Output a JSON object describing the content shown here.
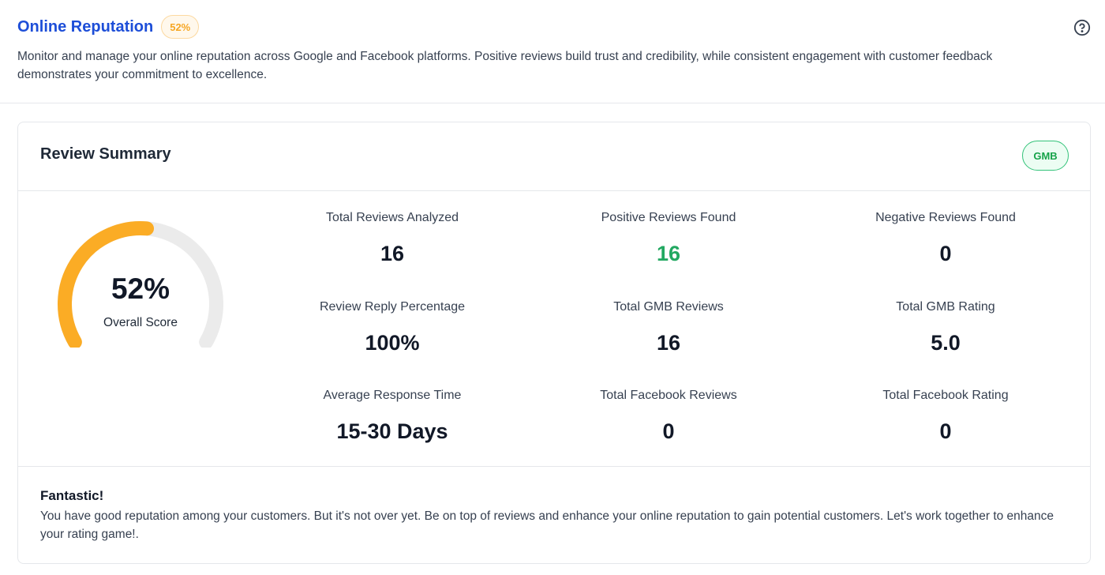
{
  "header": {
    "title": "Online Reputation",
    "score_pill": "52%",
    "description": "Monitor and manage your online reputation across Google and Facebook platforms. Positive reviews build trust and credibility, while consistent engagement with customer feedback demonstrates your commitment to excellence."
  },
  "summary": {
    "title": "Review Summary",
    "badge": "GMB",
    "gauge": {
      "value_text": "52%",
      "label": "Overall Score",
      "fraction": 0.52,
      "fill_color": "#fbac25",
      "track_color": "#ebebeb"
    },
    "stats": [
      {
        "label": "Total Reviews Analyzed",
        "value": "16",
        "tone": "default"
      },
      {
        "label": "Positive Reviews Found",
        "value": "16",
        "tone": "positive"
      },
      {
        "label": "Negative Reviews Found",
        "value": "0",
        "tone": "default"
      },
      {
        "label": "Review Reply Percentage",
        "value": "100%",
        "tone": "default"
      },
      {
        "label": "Total GMB Reviews",
        "value": "16",
        "tone": "default"
      },
      {
        "label": "Total GMB Rating",
        "value": "5.0",
        "tone": "default"
      },
      {
        "label": "Average Response Time",
        "value": "15-30 Days",
        "tone": "default"
      },
      {
        "label": "Total Facebook Reviews",
        "value": "0",
        "tone": "default"
      },
      {
        "label": "Total Facebook Rating",
        "value": "0",
        "tone": "default"
      }
    ]
  },
  "feedback": {
    "title": "Fantastic!",
    "text": "You have good reputation among your customers. But it's not over yet. Be on top of reviews and enhance your online reputation to gain potential customers. Let's work together to enhance your rating game!."
  },
  "colors": {
    "accent_blue": "#1d4ed8",
    "positive_green": "#22a861",
    "gauge_orange": "#fbac25"
  },
  "icons": {
    "help": "question-circle-icon"
  }
}
